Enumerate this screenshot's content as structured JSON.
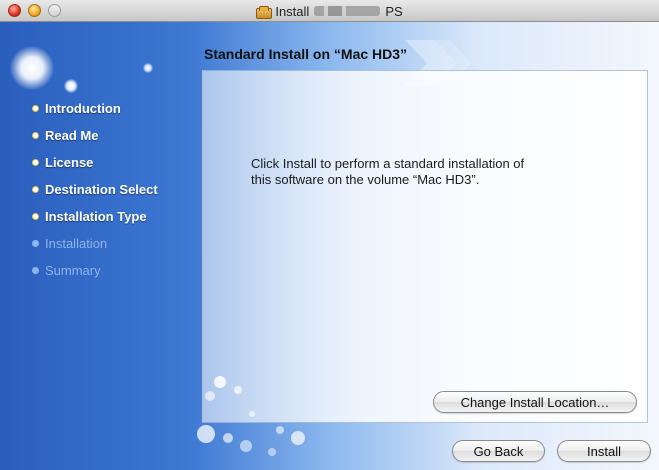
{
  "window": {
    "title_prefix": "Install",
    "title_suffix": "PS",
    "title_obscured": true
  },
  "heading": "Standard Install on “Mac HD3”",
  "sidebar": {
    "steps": [
      {
        "label": "Introduction",
        "state": "completed"
      },
      {
        "label": "Read Me",
        "state": "completed"
      },
      {
        "label": "License",
        "state": "completed"
      },
      {
        "label": "Destination Select",
        "state": "completed"
      },
      {
        "label": "Installation Type",
        "state": "current"
      },
      {
        "label": "Installation",
        "state": "pending"
      },
      {
        "label": "Summary",
        "state": "pending"
      }
    ]
  },
  "main": {
    "message_line1": "Click Install to perform a standard installation of",
    "message_line2": "this software on the volume “Mac HD3”."
  },
  "buttons": {
    "change_location": "Change Install Location…",
    "go_back": "Go Back",
    "install": "Install"
  },
  "colors": {
    "sidebar_blue": "#2a5ebd",
    "step_disabled": "#8fb4ea",
    "step_active": "#ffffff"
  },
  "icons": {
    "title_icon": "package-icon",
    "step_bullet": "bullet-icon"
  }
}
